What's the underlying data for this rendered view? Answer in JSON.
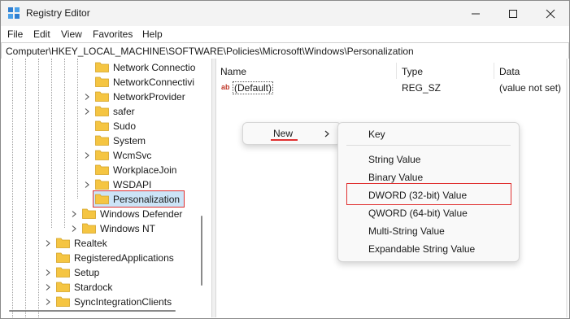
{
  "window": {
    "title": "Registry Editor",
    "minimize_icon": "minimize-icon",
    "maximize_icon": "maximize-icon",
    "close_icon": "close-icon"
  },
  "menubar": [
    "File",
    "Edit",
    "View",
    "Favorites",
    "Help"
  ],
  "address": "Computer\\HKEY_LOCAL_MACHINE\\SOFTWARE\\Policies\\Microsoft\\Windows\\Personalization",
  "tree": {
    "items": [
      {
        "label": "Network Connectio",
        "expandable": false
      },
      {
        "label": "NetworkConnectivi",
        "expandable": false
      },
      {
        "label": "NetworkProvider",
        "expandable": true
      },
      {
        "label": "safer",
        "expandable": true
      },
      {
        "label": "Sudo",
        "expandable": false
      },
      {
        "label": "System",
        "expandable": false
      },
      {
        "label": "WcmSvc",
        "expandable": true
      },
      {
        "label": "WorkplaceJoin",
        "expandable": false
      },
      {
        "label": "WSDAPI",
        "expandable": true
      },
      {
        "label": "Personalization",
        "expandable": false,
        "selected": true
      },
      {
        "label": "Windows Defender",
        "expandable": true
      },
      {
        "label": "Windows NT",
        "expandable": true
      },
      {
        "label": "Realtek",
        "expandable": true
      },
      {
        "label": "RegisteredApplications",
        "expandable": false
      },
      {
        "label": "Setup",
        "expandable": true
      },
      {
        "label": "Stardock",
        "expandable": true
      },
      {
        "label": "SyncIntegrationClients",
        "expandable": true
      }
    ]
  },
  "list": {
    "columns": [
      "Name",
      "Type",
      "Data"
    ],
    "rows": [
      {
        "name": "(Default)",
        "type": "REG_SZ",
        "data": "(value not set)",
        "icon": "ab-string-icon"
      }
    ]
  },
  "context_menu": {
    "new_label": "New",
    "submenu": [
      "Key",
      "String Value",
      "Binary Value",
      "DWORD (32-bit) Value",
      "QWORD (64-bit) Value",
      "Multi-String Value",
      "Expandable String Value"
    ],
    "highlighted": "DWORD (32-bit) Value"
  },
  "colors": {
    "annotation_red": "#e03030",
    "folder_yellow": "#f5c542",
    "selection_blue": "#cce4f7"
  }
}
